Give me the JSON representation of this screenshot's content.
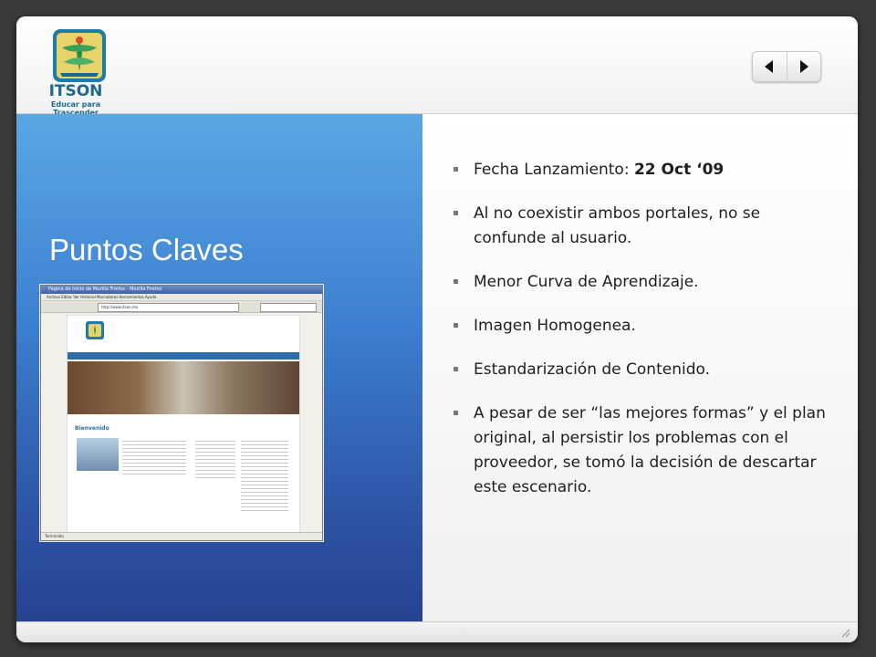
{
  "logo": {
    "title": "ITSON",
    "subtitle_line1": "Educar para",
    "subtitle_line2": "Trascender"
  },
  "nav": {
    "prev_icon": "triangle-left-icon",
    "next_icon": "triangle-right-icon"
  },
  "slide": {
    "title": "Puntos Claves"
  },
  "screenshot": {
    "window_title": "Página de Inicio de Mozilla Firefox - Mozilla Firefox",
    "menu": "Archivo   Editar   Ver   Historial   Marcadores   Herramientas   Ayuda",
    "url": "http://www.itson.mx",
    "section_heading": "Bienvenido",
    "status_text": "Terminado"
  },
  "bullets": [
    {
      "text": "Fecha Lanzamiento: ",
      "bold": "22 Oct ‘09"
    },
    {
      "text": "Al no coexistir ambos portales, no se confunde al usuario.",
      "bold": ""
    },
    {
      "text": "Menor Curva de Aprendizaje.",
      "bold": ""
    },
    {
      "text": "Imagen Homogenea.",
      "bold": ""
    },
    {
      "text": "Estandarización de Contenido.",
      "bold": ""
    },
    {
      "text": "A pesar de ser “las mejores formas” y el plan original, al persistir los problemas con el proveedor, se tomó la decisión de descartar este escenario.",
      "bold": ""
    }
  ],
  "colors": {
    "background": "#3a3a3a",
    "left_panel_top": "#5aa7e4",
    "left_panel_bottom": "#243f8c",
    "text": "#1f1f1f",
    "logo": "#1c6a8c"
  }
}
